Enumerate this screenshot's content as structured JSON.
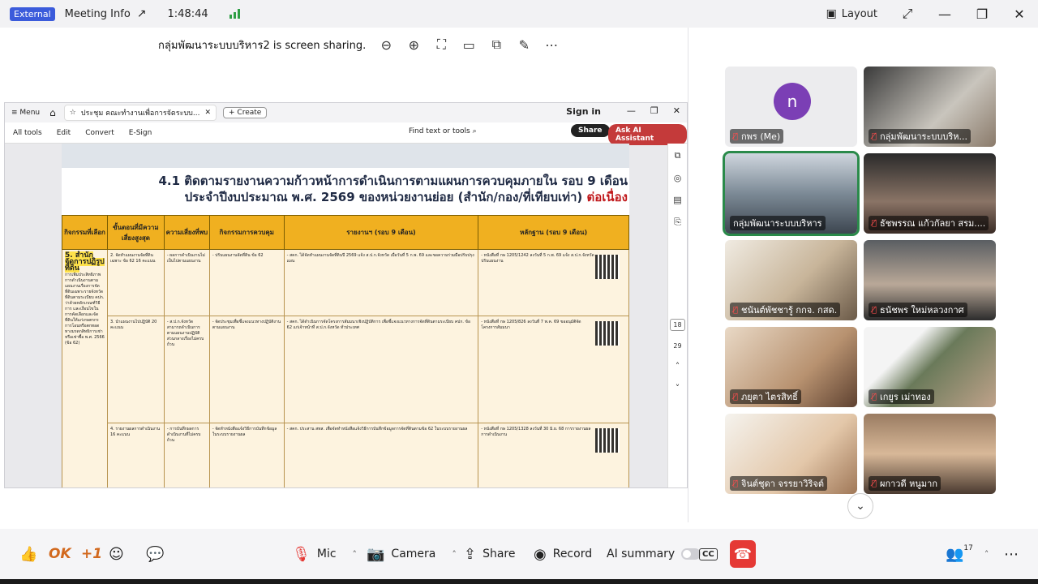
{
  "titlebar": {
    "badge": "External",
    "meeting_info": "Meeting Info",
    "timer": "1:48:44",
    "layout_label": "Layout"
  },
  "share": {
    "status": "กลุ่มพัฒนาระบบบริหาร2 is screen sharing."
  },
  "viewer": {
    "menu": "Menu",
    "tab_title": "ประชุม คณะทำงานเพื่อการจัดระบบ...",
    "create": "Create",
    "sign_in": "Sign in",
    "tools": [
      "All tools",
      "Edit",
      "Convert",
      "E-Sign"
    ],
    "find": "Find text or tools",
    "share": "Share",
    "ai": "Ask AI Assistant",
    "page_number": "18",
    "page_total": "29"
  },
  "doc": {
    "title_line1": "4.1 ติดตามรายงานความก้าวหน้าการดำเนินการตามแผนการควบคุมภายใน รอบ 9 เดือน",
    "title_line2": "ประจำปีงบประมาณ พ.ศ. 2569 ของหน่วยงานย่อย (สำนัก/กอง/ที่เทียบเท่า)",
    "title_red": "ต่อเนื่อง",
    "headers": [
      "กิจกรรมที่เลือก",
      "ขั้นตอนที่มีความเสี่ยงสูงสุด",
      "ความเสี่ยงที่พบ",
      "กิจกรรมการควบคุม",
      "รายงานฯ (รอบ 9 เดือน)",
      "หลักฐาน (รอบ 9 เดือน)"
    ],
    "unit_highlight": "5. สำนักจัดการปฏิรูปที่ดิน",
    "unit_desc": "การเพิ่มประสิทธิภาพการดำเนินงานตามแผนงานเรื่องการจัดที่ดินเฉพาะรายจังหวัดที่ดินตามระเบียบ คปก. ว่าด้วยหลักเกณฑ์วิธีการ และเงื่อนไขในการคัดเลือกและจัดที่ดินให้แก่เกษตรกร การโอนหรือตกทอดทางมรดกสิทธิการเช่าหรือเช่าซื้อ พ.ศ. 2566 (ข้อ 62)",
    "steps": [
      "2. จัดทำแผนงานจัดที่ดินเฉพาะ ข้อ 62 16 คะแนน",
      "3. นำแผนงานไปปฏิบัติ 20 คะแนน",
      "4. รายงานผลการดำเนินงาน 16 คะแนน"
    ],
    "risks": [
      "- ผลการดำเนินงานไม่เป็นไปตามแผนงาน",
      "- ส.ป.ก.จังหวัด สามารถดำเนินการตามแผนงานปฏิบัติส่วนกลางเรื่องไม่ครบถ้วน",
      "- การบันทึกผลการดำเนินงานที่ไม่ครบถ้วน"
    ],
    "controls": [
      "- ปรับแผนงานจัดที่ดิน ข้อ 62",
      "- จัดประชุมเพื่อชี้แจงแนวทางปฏิบัติงานตามแผนงาน",
      "- จัดทำหนังสือแจ้งวิธีการบันทึกข้อมูลในระบบรายงานผล"
    ],
    "reports": [
      "- สคก. ได้จัดทำแผนงานจัดที่ดินปี 2569 แจ้ง ส.ป.ก.จังหวัด เมื่อวันที่ 5 ก.พ. 69 และขอความร่วมมือปรับปรุงแผน",
      "- สคก. ได้ดำเนินการจัดโครงการสัมมนาเชิงปฏิบัติการ เพื่อชี้แจงแนวทางการจัดที่ดินตามระเบียบ คปก. ข้อ 62 แก่เจ้าหน้าที่ ส.ป.ก.จังหวัด ทั่วประเทศ",
      "- สคก. ประสาน สทส. เพื่อจัดทำหนังสือแจ้งวิธีการบันทึกข้อมูลการจัดที่ดินตามข้อ 62 ในระบบรายงานผล"
    ],
    "evidence": [
      "- หนังสือที่ กษ 1205/1242 ลงวันที่ 5 ก.พ. 69 แจ้ง ส.ป.ก.จังหวัด ปรับแผนงาน",
      "- หนังสือที่ กษ 1205/826 ลงวันที่ 7 พ.ค. 69 ขออนุมัติจัดโครงการสัมมนา",
      "- หนังสือที่ กษ 1205/1328 ลงวันที่ 30 มิ.ย. 68 การรายงานผลการดำเนินงาน"
    ]
  },
  "participants": [
    {
      "name": "กพร (Me)",
      "avatar_letter": "n",
      "muted": true,
      "type": "avatar"
    },
    {
      "name": "กลุ่มพัฒนาระบบบริห...",
      "muted": true,
      "type": "video"
    },
    {
      "name": "กลุ่มพัฒนาระบบบริหาร",
      "muted": false,
      "type": "video",
      "active": true
    },
    {
      "name": "ธัชพรรณ แก้วกัลยา สรม....",
      "muted": true,
      "type": "video"
    },
    {
      "name": "ชนันต์พัชชารู้ กกจ. กสด.",
      "muted": true,
      "type": "video"
    },
    {
      "name": "ธนัชพร ใหม่หลวงกาศ",
      "muted": true,
      "type": "video"
    },
    {
      "name": "ภยุตา ไตรสิทธิ์",
      "muted": true,
      "type": "video"
    },
    {
      "name": "เกยูร เม่าทอง",
      "muted": true,
      "type": "video"
    },
    {
      "name": "จินต์ชุดา จรรยาวิริจต์",
      "muted": true,
      "type": "video"
    },
    {
      "name": "ผกาวดี หนูมาก",
      "muted": true,
      "type": "video"
    }
  ],
  "toolbar": {
    "ok": "OK",
    "plus_one": "+1",
    "mic": "Mic",
    "camera": "Camera",
    "share": "Share",
    "record": "Record",
    "ai_summary": "AI summary",
    "cc": "CC",
    "participants_count": "17"
  },
  "colors": {
    "accent": "#3b5bdb",
    "active_border": "#2a8a4a",
    "muted": "#e53935",
    "leave": "#e53935",
    "table_header": "#f0b020"
  }
}
